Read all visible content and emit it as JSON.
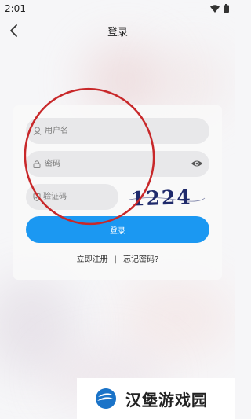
{
  "status_bar": {
    "time": "2:01"
  },
  "header": {
    "title": "登录"
  },
  "form": {
    "username": {
      "placeholder": "用户名",
      "value": ""
    },
    "password": {
      "placeholder": "密码",
      "value": ""
    },
    "captcha_input": {
      "placeholder": "验证码",
      "value": ""
    },
    "captcha_code": "1224",
    "login_label": "登录",
    "register_label": "立即注册",
    "separator": "|",
    "forgot_label": "忘记密码?"
  },
  "watermark": {
    "text": "汉堡游戏园"
  },
  "colors": {
    "primary": "#1b98f2",
    "field_bg": "#e8e8ea",
    "annotation": "#c8282a",
    "captcha_ink": "#1f2a6b"
  }
}
